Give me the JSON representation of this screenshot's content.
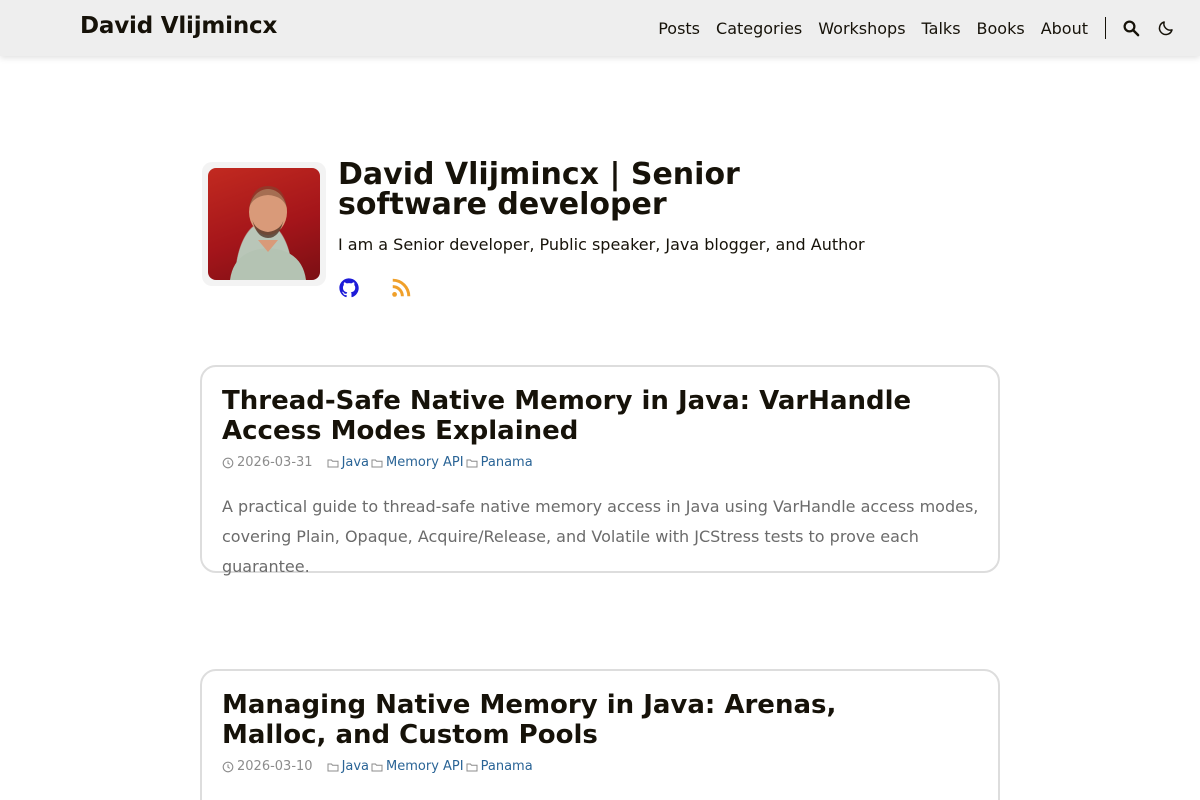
{
  "header": {
    "site_title": "David Vlijmincx",
    "nav": [
      {
        "label": "Posts"
      },
      {
        "label": "Categories"
      },
      {
        "label": "Workshops"
      },
      {
        "label": "Talks"
      },
      {
        "label": "Books"
      },
      {
        "label": "About"
      }
    ],
    "icons": {
      "search": "search-icon",
      "theme": "moon-icon"
    }
  },
  "profile": {
    "title": "David Vlijmincx | Senior software developer",
    "subtitle": "I am a Senior developer, Public speaker, Java blogger, and Author",
    "social": [
      {
        "icon": "github-icon",
        "color": "#1d1bd8"
      },
      {
        "icon": "rss-icon",
        "color": "#f0a02a"
      }
    ]
  },
  "posts": [
    {
      "title": "Thread-Safe Native Memory in Java: VarHandle Access Modes Explained",
      "date": "2026-03-31",
      "categories": [
        "Java",
        "Memory API",
        "Panama"
      ],
      "summary": "A practical guide to thread-safe native memory access in Java using VarHandle access modes, covering Plain, Opaque, Acquire/Release, and Volatile with JCStress tests to prove each guarantee."
    },
    {
      "title": "Managing Native Memory in Java: Arenas, Malloc, and Custom Pools",
      "date": "2026-03-10",
      "categories": [
        "Java",
        "Memory API",
        "Panama"
      ]
    }
  ],
  "colors": {
    "header_bg": "#eeeeee",
    "text": "#161209",
    "link": "#2a6496",
    "muted": "#8c8c8c",
    "summary": "#6b6b6b",
    "card_border": "#dddddd"
  }
}
